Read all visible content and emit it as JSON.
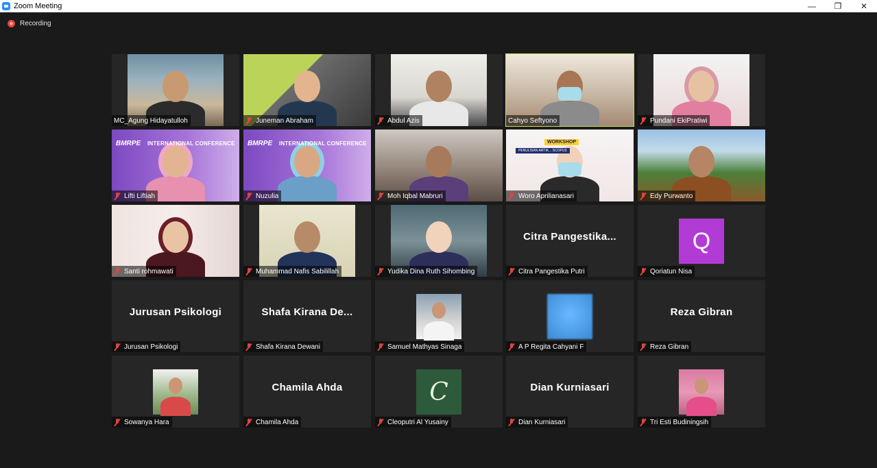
{
  "window": {
    "title": "Zoom Meeting",
    "minimize_icon": "minimize-icon",
    "restore_icon": "restore-icon",
    "close_icon": "close-icon"
  },
  "recording": {
    "label": "Recording",
    "icon": "recording-icon",
    "color": "#e0443e"
  },
  "active_speaker_color": "#c4e05a",
  "participants": [
    {
      "name": "MC_Agung Hidayatulloh",
      "muted": false,
      "type": "video"
    },
    {
      "name": "Juneman Abraham",
      "muted": true,
      "type": "video"
    },
    {
      "name": "Abdul Azis",
      "muted": true,
      "type": "video"
    },
    {
      "name": "Cahyo Seftyono",
      "muted": false,
      "type": "video",
      "active_speaker": true
    },
    {
      "name": "Pundani EkiPratiwi",
      "muted": true,
      "type": "video"
    },
    {
      "name": "Lifti Liftiah",
      "muted": true,
      "type": "video",
      "overlay": {
        "logo": "BMRPE",
        "text": "INTERNATIONAL CONFERENCE"
      }
    },
    {
      "name": "Nuzulia",
      "muted": true,
      "type": "video",
      "overlay": {
        "logo": "BMRPE",
        "text": "INTERNATIONAL CONFERENCE"
      }
    },
    {
      "name": "Moh Iqbal Mabruri",
      "muted": true,
      "type": "video"
    },
    {
      "name": "Woro Aprilianasari",
      "muted": true,
      "type": "video",
      "overlay": {
        "text": "WORKSHOP",
        "sub": "PENULISAN ARTIK... SCOPUS"
      }
    },
    {
      "name": "Edy Purwanto",
      "muted": true,
      "type": "video"
    },
    {
      "name": "Santi rohmawati",
      "muted": true,
      "type": "video"
    },
    {
      "name": "Muhammad Nafis Sabilillah",
      "muted": true,
      "type": "video"
    },
    {
      "name": "Yudika Dina Ruth Sihombing",
      "muted": true,
      "type": "video"
    },
    {
      "name": "Citra Pangestika Putri",
      "muted": true,
      "type": "name",
      "display": "Citra  Pangestika..."
    },
    {
      "name": "Qoriatun Nisa",
      "muted": true,
      "type": "letter",
      "letter": "Q",
      "color": "#b23bd6"
    },
    {
      "name": "Jurusan Psikologi",
      "muted": true,
      "type": "name",
      "display": "Jurusan Psikologi"
    },
    {
      "name": "Shafa Kirana Dewani",
      "muted": true,
      "type": "name",
      "display": "Shafa  Kirana  De..."
    },
    {
      "name": "Samuel Mathyas Sinaga",
      "muted": true,
      "type": "photo"
    },
    {
      "name": "A P Regita Cahyani F",
      "muted": true,
      "type": "blur"
    },
    {
      "name": "Reza Gibran",
      "muted": true,
      "type": "name",
      "display": "Reza Gibran"
    },
    {
      "name": "Sowanya Hara",
      "muted": true,
      "type": "photo"
    },
    {
      "name": "Chamila Ahda",
      "muted": true,
      "type": "name",
      "display": "Chamila Ahda"
    },
    {
      "name": "Cleoputri Al Yusainy",
      "muted": true,
      "type": "monogram",
      "letter": "C"
    },
    {
      "name": "Dian Kurniasari",
      "muted": true,
      "type": "name",
      "display": "Dian Kurniasari"
    },
    {
      "name": "Tri Esti Budiningsih",
      "muted": true,
      "type": "photo"
    }
  ]
}
